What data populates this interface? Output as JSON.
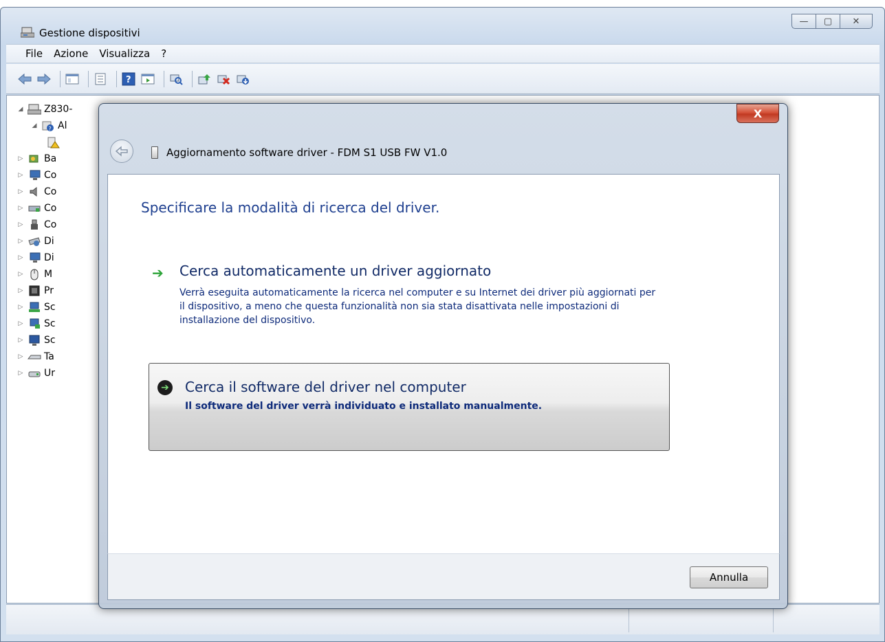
{
  "window": {
    "title": "Gestione dispositivi",
    "caption": {
      "minimize": "—",
      "maximize": "▢",
      "close": "✕"
    }
  },
  "menu": [
    "File",
    "Azione",
    "Visualizza",
    "?"
  ],
  "toolbar": {
    "icons": [
      "back-arrow-icon",
      "forward-arrow-icon",
      "console-tree-icon",
      "properties-icon",
      "help-icon",
      "action-pane-icon",
      "scan-hardware-icon",
      "update-driver-icon",
      "disable-device-icon",
      "uninstall-device-icon"
    ]
  },
  "tree": {
    "root": "Z830-",
    "items": [
      {
        "label": "Al",
        "icon": "unknown-device-icon"
      },
      {
        "label": "Ba",
        "icon": "battery-icon"
      },
      {
        "label": "Co",
        "icon": "computer-icon"
      },
      {
        "label": "Co",
        "icon": "sound-icon"
      },
      {
        "label": "Co",
        "icon": "network-icon"
      },
      {
        "label": "Co",
        "icon": "usb-plug-icon"
      },
      {
        "label": "Di",
        "icon": "disk-icon"
      },
      {
        "label": "Di",
        "icon": "display-icon"
      },
      {
        "label": "M",
        "icon": "mouse-icon"
      },
      {
        "label": "Pr",
        "icon": "processor-icon"
      },
      {
        "label": "Sc",
        "icon": "network-adapter-icon"
      },
      {
        "label": "Sc",
        "icon": "adapter-icon"
      },
      {
        "label": "Sc",
        "icon": "monitor-icon"
      },
      {
        "label": "Ta",
        "icon": "keyboard-icon"
      },
      {
        "label": "Ur",
        "icon": "storage-icon"
      }
    ]
  },
  "dialog": {
    "title": "Aggiornamento software driver - FDM S1 USB FW V1.0",
    "close_label": "X",
    "heading": "Specificare la modalità di ricerca del driver.",
    "option_auto": {
      "title": "Cerca automaticamente un driver aggiornato",
      "description": "Verrà eseguita automaticamente la ricerca nel computer e su Internet dei driver più aggiornati per il dispositivo, a meno che questa funzionalità non sia stata disattivata nelle impostazioni di installazione del dispositivo."
    },
    "option_manual": {
      "title": "Cerca il software del driver nel computer",
      "description": "Il software del driver verrà individuato e installato manualmente."
    },
    "cancel_label": "Annulla"
  }
}
